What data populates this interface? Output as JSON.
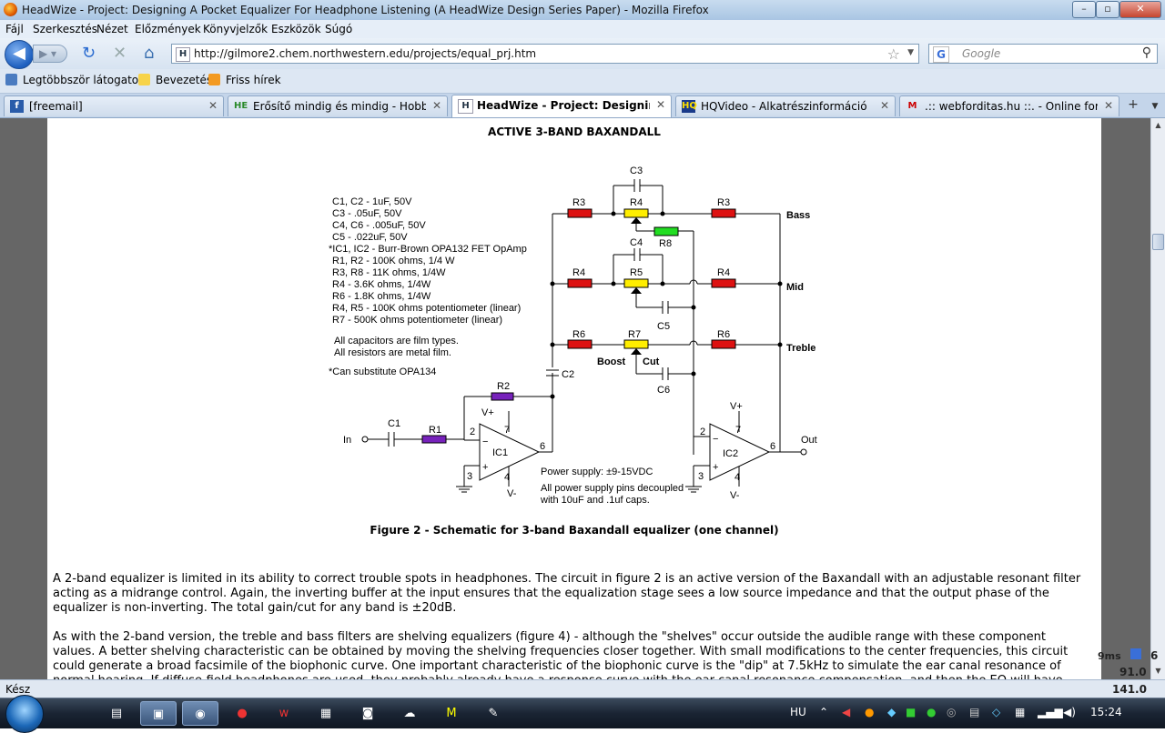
{
  "window": {
    "title": "HeadWize - Project: Designing A Pocket Equalizer For Headphone Listening (A HeadWize Design Series Paper) - Mozilla Firefox"
  },
  "menu": [
    "Fájl",
    "Szerkesztés",
    "Nézet",
    "Előzmények",
    "Könyvjelzők",
    "Eszközök",
    "Súgó"
  ],
  "nav": {
    "url": "http://gilmore2.chem.northwestern.edu/projects/equal_prj.htm",
    "search_placeholder": "Google"
  },
  "bookmarks": [
    "Legtöbbször látogatott",
    "Bevezetés",
    "Friss hírek"
  ],
  "tabs": [
    {
      "label": "[freemail]",
      "icon": "f",
      "active": false
    },
    {
      "label": "Erősítő mindig és mindig - Hobbie...",
      "icon": "HE",
      "active": false
    },
    {
      "label": "HeadWize - Project: Designing A ...",
      "icon": "H",
      "active": true
    },
    {
      "label": "HQVideo - Alkatrészinformáció",
      "icon": "HQ",
      "active": false
    },
    {
      "label": ".:: webforditas.hu ::. - Online fordít...",
      "icon": "M",
      "active": false
    }
  ],
  "page": {
    "heading": "ACTIVE 3-BAND BAXANDALL",
    "caption": "Figure 2  -  Schematic for 3-band Baxandall equalizer (one channel)",
    "paragraph1": "A 2-band equalizer is limited in its ability to correct trouble spots in headphones. The circuit in figure 2 is an active version of the Baxandall with an adjustable resonant filter acting as a midrange control. Again, the inverting buffer at the input ensures that the equalization stage sees a low source impedance and that the output phase of the equalizer is non-inverting. The total gain/cut for any band is ±20dB.",
    "paragraph2": "As with the 2-band version, the treble and bass filters are shelving equalizers (figure 4) - although the \"shelves\" occur outside the audible range with these component values. A better shelving characteristic can be obtained by moving the shelving frequencies closer together. With small modifications to the center frequencies, this circuit could generate a broad facsimile of the biophonic curve. One important characteristic of the biophonic curve is the \"dip\" at 7.5kHz to simulate the ear canal resonance of normal hearing. If diffuse-field headphones are used, they probably already have a response curve with the ear canal resonance compensation, and then the EQ will have"
  },
  "schematic": {
    "parts_list": [
      "C1, C2  -  1uF, 50V",
      "C3  -  .05uF, 50V",
      "C4, C6  -  .005uF, 50V",
      "C5  -  .022uF, 50V",
      "*IC1, IC2  -  Burr-Brown OPA132 FET OpAmp",
      "R1, R2  -  100K ohms, 1/4 W",
      "R3, R8  -  11K ohms, 1/4W",
      "R4  -  3.6K ohms, 1/4W",
      "R6  -  1.8K ohms, 1/4W",
      "R4, R5  -  100K ohms potentiometer (linear)",
      "R7  -  500K ohms potentiometer (linear)"
    ],
    "notes": [
      "All capacitors are film types.",
      "All resistors are metal film."
    ],
    "substitute": "*Can substitute OPA134",
    "power": [
      "Power supply: ±9-15VDC",
      "All power supply pins decoupled",
      "with 10uF and .1uf caps."
    ],
    "labels": {
      "C1": "C1",
      "C2": "C2",
      "C3": "C3",
      "C4": "C4",
      "C5": "C5",
      "C6": "C6",
      "R1": "R1",
      "R2": "R2",
      "R3": "R3",
      "R4": "R4",
      "R5": "R5",
      "R6": "R6",
      "R7": "R7",
      "R8": "R8",
      "IC1": "IC1",
      "IC2": "IC2",
      "bass": "Bass",
      "mid": "Mid",
      "treble": "Treble",
      "boost": "Boost",
      "cut": "Cut",
      "in": "In",
      "out": "Out",
      "vplus": "V+",
      "vminus": "V-",
      "pin2": "2",
      "pin3": "3",
      "pin4": "4",
      "pin6": "6",
      "pin7": "7",
      "minus": "−",
      "plus": "+"
    },
    "colors": {
      "red": "#dd1111",
      "yellow": "#ffee00",
      "green": "#22dd22",
      "purple": "#7722bb"
    }
  },
  "status": {
    "text": "Kész"
  },
  "gadget": {
    "ms": "9ms",
    "n1": "6",
    "v1": "91.0",
    "v2": "141.0"
  },
  "taskbar": {
    "lang": "HU",
    "clock": "15:24"
  }
}
